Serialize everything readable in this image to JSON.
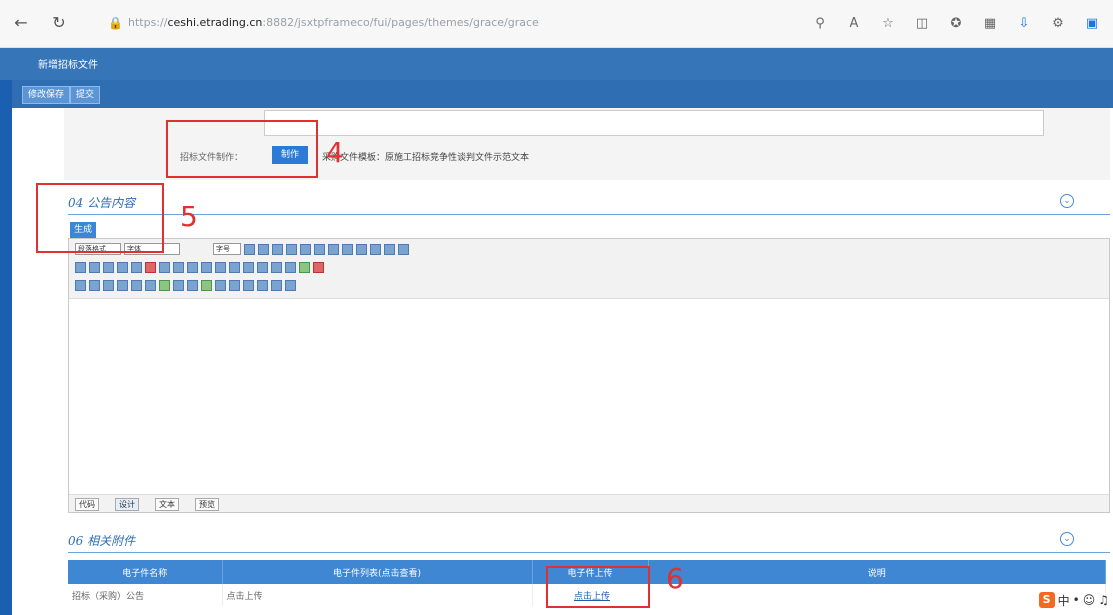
{
  "browser": {
    "url_prefix": "https://",
    "url_domain": "ceshi.etrading.cn",
    "url_rest": ":8882/jsxtpframeco/fui/pages/themes/grace/grace",
    "icons": [
      "back-icon",
      "refresh-icon",
      "lock-icon",
      "zoom-icon",
      "read-aloud-icon",
      "favorite-icon",
      "split-screen-icon",
      "favorites-bar-icon",
      "collections-icon",
      "download-icon",
      "extensions-icon",
      "office-icon"
    ]
  },
  "app": {
    "window_title": "新增招标文件",
    "toolbar": {
      "save_label": "修改保存",
      "submit_label": "提交"
    }
  },
  "form": {
    "make_label": "招标文件制作：",
    "make_button": "制作",
    "template_text": "采购文件模板：原施工招标竞争性谈判文件示范文本"
  },
  "sections": {
    "announcement": {
      "title": "04 公告内容",
      "generate_button": "生成",
      "editor_select_1": "段落格式",
      "editor_select_2": "字体",
      "editor_select_3": "字号",
      "tabs": [
        "代码",
        "设计",
        "文本",
        "预览"
      ]
    },
    "attachments": {
      "title": "06 相关附件",
      "columns": [
        "电子件名称",
        "电子件列表(点击查看)",
        "电子件上传",
        "说明"
      ],
      "rows": [
        {
          "name": "招标（采购）公告",
          "list": "点击上传",
          "upload": "点击上传",
          "note": ""
        }
      ]
    }
  },
  "annotations": {
    "step4": "4",
    "step5": "5",
    "step6": "6"
  },
  "colors": {
    "header_blue": "#3575b8",
    "accent_blue": "#2b7ad6",
    "annotation_red": "#e03030"
  }
}
